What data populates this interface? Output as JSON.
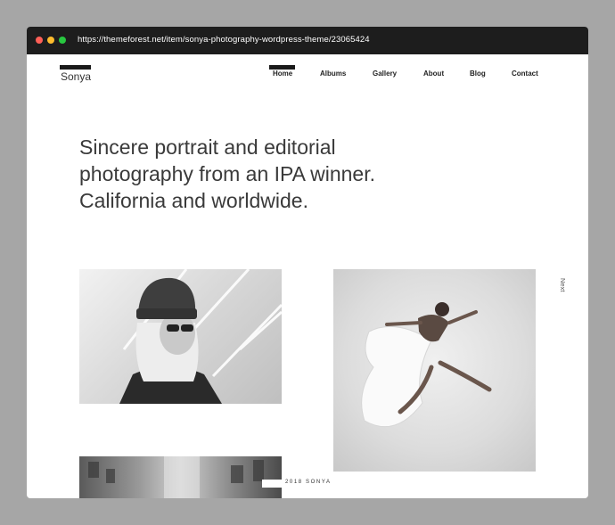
{
  "browser": {
    "url": "https://themeforest.net/item/sonya-photography-wordpress-theme/23065424"
  },
  "site": {
    "logo": "Sonya"
  },
  "nav": {
    "items": [
      {
        "label": "Home",
        "active": true
      },
      {
        "label": "Albums",
        "active": false
      },
      {
        "label": "Gallery",
        "active": false
      },
      {
        "label": "About",
        "active": false
      },
      {
        "label": "Blog",
        "active": false
      },
      {
        "label": "Contact",
        "active": false
      }
    ]
  },
  "hero": {
    "lines": [
      "Sincere portrait and editorial",
      "photography from an IPA winner.",
      "California and worldwide."
    ]
  },
  "slider": {
    "next_label": "Next"
  },
  "gallery": {
    "caption": "2018 SONYA"
  },
  "colors": {
    "titlebar": "#1d1d1d",
    "page_background": "#ffffff",
    "outer_background": "#a6a6a6",
    "text": "#3a3a3a",
    "accent_bar": "#1a1a1a"
  }
}
